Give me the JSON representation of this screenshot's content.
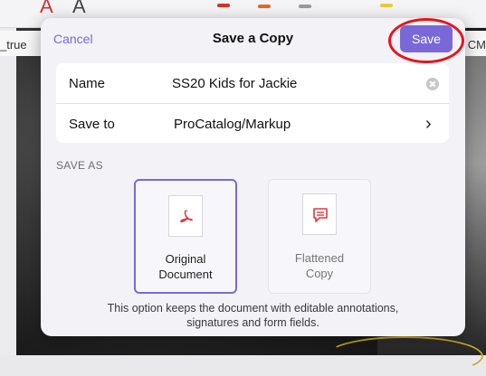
{
  "background": {
    "left_text": "_true",
    "right_text": "CM"
  },
  "dialog": {
    "title": "Save a Copy",
    "cancel_label": "Cancel",
    "save_label": "Save",
    "fields": {
      "name_label": "Name",
      "name_value": "SS20 Kids for Jackie",
      "save_to_label": "Save to",
      "save_to_value": "ProCatalog/Markup"
    },
    "save_as_header": "SAVE AS",
    "options": [
      {
        "label_line1": "Original",
        "label_line2": "Document",
        "selected": true,
        "icon": "pdf-icon"
      },
      {
        "label_line1": "Flattened",
        "label_line2": "Copy",
        "selected": false,
        "icon": "annotation-icon"
      }
    ],
    "description_line1": "This option keeps the document with editable annotations,",
    "description_line2": "signatures and form fields."
  },
  "colors": {
    "accent": "#7b68d8",
    "annotation_red": "#e8141b",
    "icon_red": "#e0393e"
  }
}
